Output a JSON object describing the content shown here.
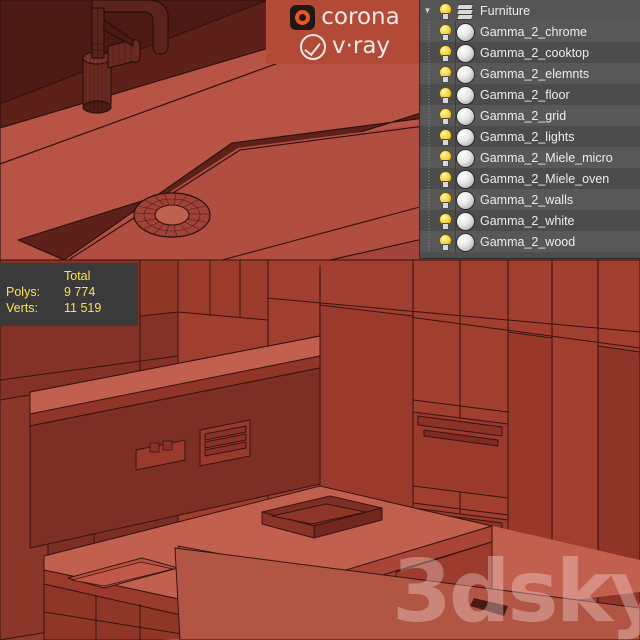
{
  "window": {
    "title": "3D Viewport Clay Render"
  },
  "logos": {
    "corona": {
      "text": "corona",
      "mark": "corona-ring-icon",
      "accent": "#e8581f"
    },
    "vray": {
      "text": "v·ray",
      "mark": "vray-check-circle-icon"
    },
    "panel_bg": "#b24a37"
  },
  "layer_panel": {
    "expand_icon": "▼",
    "group_bulb_icon": "lightbulb-icon",
    "group_stack_icon": "layer-stack-icon",
    "group_name": "Furniture",
    "row_bulb_icon": "lightbulb-icon",
    "row_sphere_icon": "material-sphere-icon",
    "bg": "#4e4e4e",
    "text_color": "#e9eef2",
    "layers": [
      "Gamma_2_chrome",
      "Gamma_2_cooktop",
      "Gamma_2_elemnts",
      "Gamma_2_floor",
      "Gamma_2_grid",
      "Gamma_2_lights",
      "Gamma_2_Miele_micro",
      "Gamma_2_Miele_oven",
      "Gamma_2_walls",
      "Gamma_2_white",
      "Gamma_2_wood"
    ]
  },
  "stats": {
    "header": "Total",
    "polys_label": "Polys:",
    "polys_value": "9 774",
    "verts_label": "Verts:",
    "verts_value": "11 519",
    "text_color": "#ffe14d",
    "bg": "#3a3a3a"
  },
  "watermark": {
    "text": "3dsky"
  },
  "viewports": {
    "top": {
      "name": "sink-closeup-clay-render",
      "bg": "#5b201a",
      "palette": {
        "counter_light": "#b75446",
        "counter_mid": "#a1443a",
        "sink_basin": "#8a3128",
        "dark_face": "#5d211a",
        "darkest": "#4a1813",
        "faucet": "#5a231c",
        "outline": "#2d100c"
      }
    },
    "main": {
      "name": "kitchen-overview-clay-render",
      "bg": "#8f3a2e",
      "palette": {
        "floor": "#b15545",
        "counter_top": "#c2604f",
        "cab_front_light": "#a84234",
        "cab_front_mid": "#963a2d",
        "cab_front_dark": "#7d2f24",
        "wall_dark": "#6a2620",
        "shelf": "#c05c4c",
        "faucet_black": "#1d1210",
        "outline": "#3a140f"
      }
    }
  }
}
